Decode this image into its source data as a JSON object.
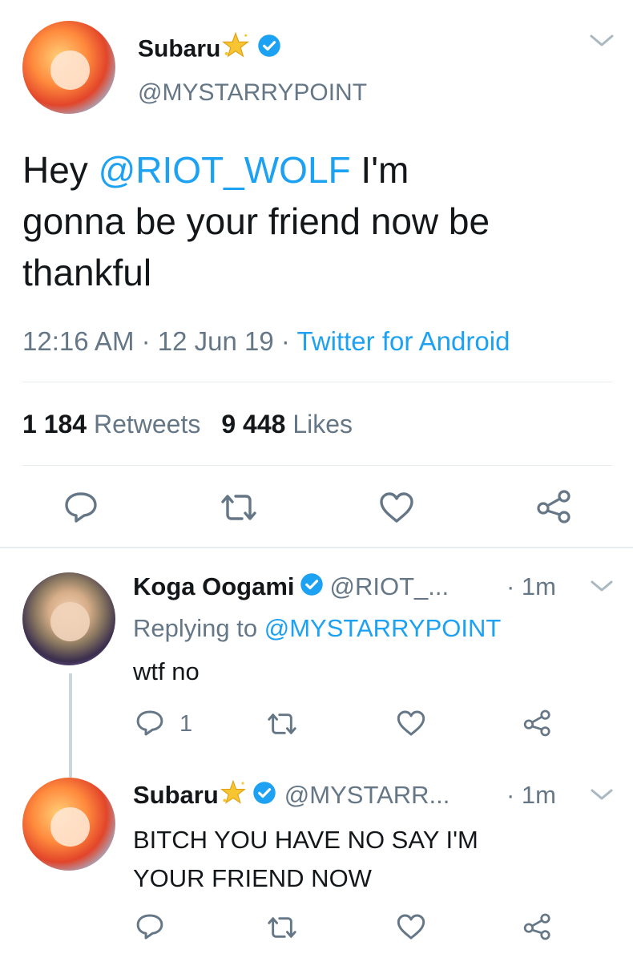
{
  "main_tweet": {
    "display_name": "Subaru",
    "handle": "@MYSTARRYPOINT",
    "text_prefix": "Hey ",
    "mention": "@RIOT_WOLF",
    "text_line1_rest": " I'm",
    "text_line2": "gonna be your friend now be",
    "text_line3": "thankful",
    "time": "12:16 AM",
    "sep1": " · ",
    "date": "12 Jun 19",
    "sep2": " · ",
    "source": "Twitter for Android",
    "retweets_count": "1 184",
    "retweets_label": "Retweets",
    "likes_count": "9 448",
    "likes_label": "Likes"
  },
  "reply1": {
    "display_name": "Koga Oogami",
    "handle": "@RIOT_...",
    "time": "· 1m",
    "replying_prefix": "Replying to ",
    "replying_to": "@MYSTARRYPOINT",
    "text": "wtf no",
    "reply_count": "1"
  },
  "reply2": {
    "display_name": "Subaru",
    "handle": "@MYSTARR...",
    "time": "· 1m",
    "text_line1": "BITCH YOU HAVE NO SAY I'M",
    "text_line2": "YOUR FRIEND NOW"
  },
  "icons": [
    "chevron-down-icon",
    "verified-icon",
    "star-icon",
    "reply-icon",
    "retweet-icon",
    "like-icon",
    "share-icon"
  ],
  "colors": {
    "accent": "#1da1f2",
    "secondary_text": "#657786",
    "divider": "#e6ecf0",
    "star": "#f7c531"
  }
}
